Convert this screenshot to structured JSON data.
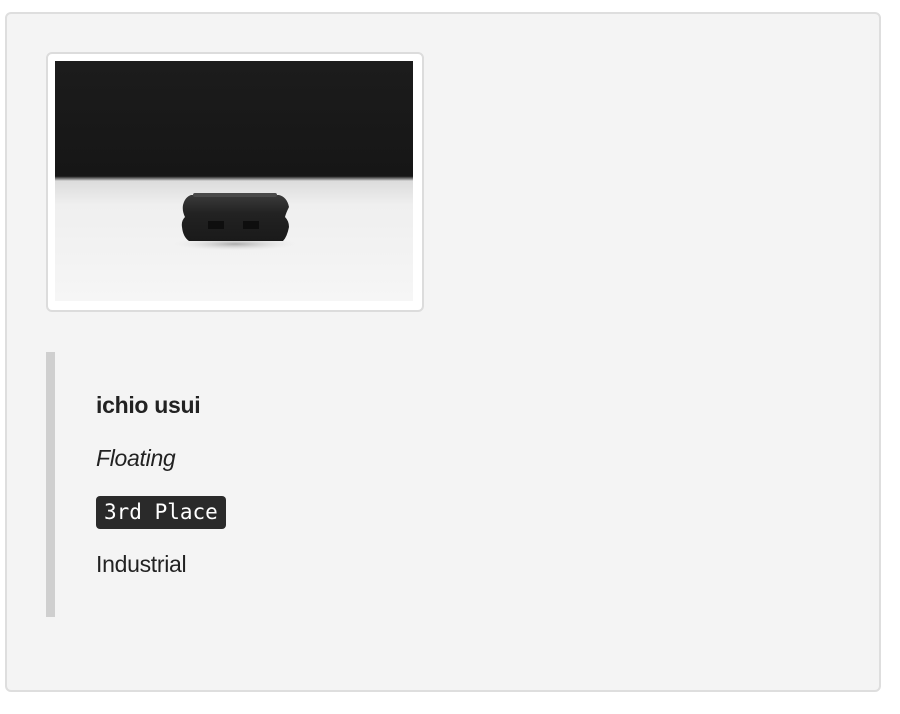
{
  "entry": {
    "designer": "ichio usui",
    "title": "Floating",
    "award": "3rd Place",
    "category": "Industrial"
  },
  "image": {
    "description_icon": "product-photo",
    "colors": {
      "background_dark": "#1a1a1a",
      "floor_light": "#f0f0f0",
      "object": "#262626"
    }
  },
  "colors": {
    "panel_background": "#f4f4f4",
    "panel_border": "#dedede",
    "quote_bar": "#cfcfcf",
    "badge_background": "#2a2a2a",
    "text": "#222222"
  }
}
